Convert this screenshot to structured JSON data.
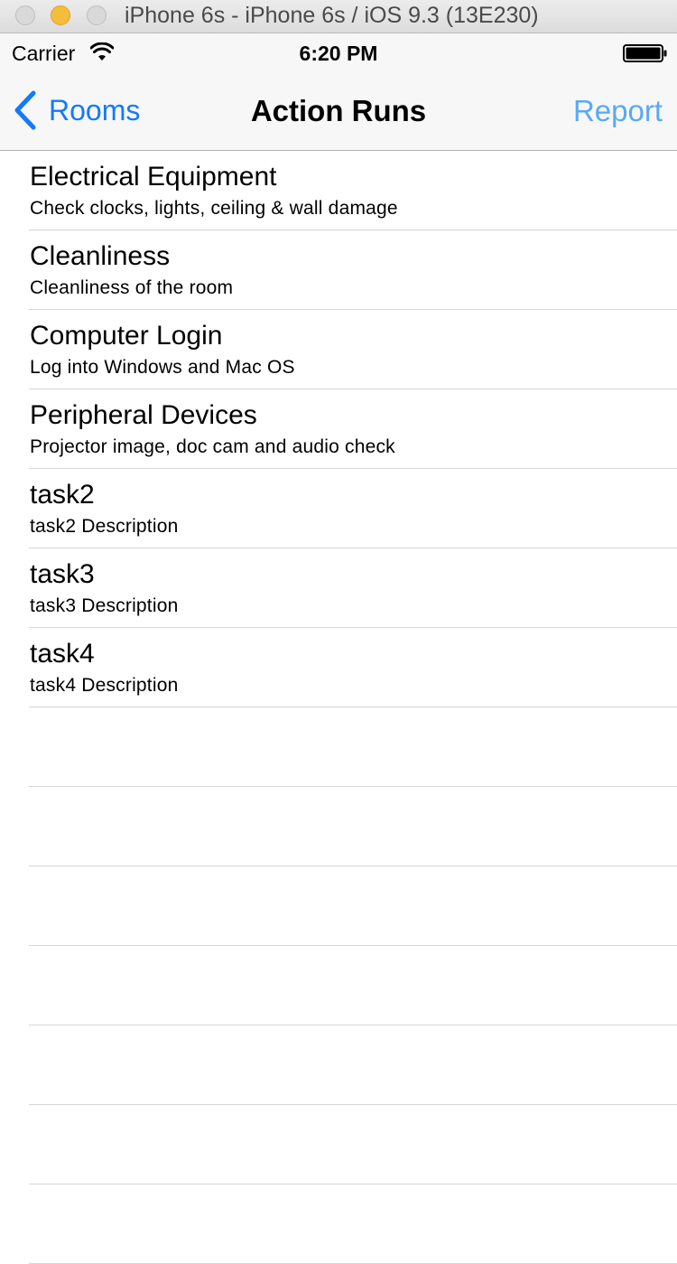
{
  "window": {
    "title": "iPhone 6s - iPhone 6s / iOS 9.3 (13E230)"
  },
  "status_bar": {
    "carrier": "Carrier",
    "time": "6:20 PM",
    "wifi_icon": "wifi-icon",
    "battery_icon": "battery-full-icon"
  },
  "nav": {
    "back_label": "Rooms",
    "back_icon": "chevron-left-icon",
    "title": "Action Runs",
    "right_label": "Report",
    "tint_color": "#1479fb",
    "right_color": "#5aa9f5"
  },
  "tasks": [
    {
      "title": "Electrical Equipment",
      "subtitle": "Check clocks, lights, ceiling & wall damage"
    },
    {
      "title": "Cleanliness",
      "subtitle": "Cleanliness of the room"
    },
    {
      "title": "Computer Login",
      "subtitle": "Log into Windows and Mac OS"
    },
    {
      "title": "Peripheral Devices",
      "subtitle": "Projector image, doc cam and audio check"
    },
    {
      "title": "task2",
      "subtitle": "task2 Description"
    },
    {
      "title": "task3",
      "subtitle": "task3 Description"
    },
    {
      "title": "task4",
      "subtitle": "task4 Description"
    }
  ]
}
